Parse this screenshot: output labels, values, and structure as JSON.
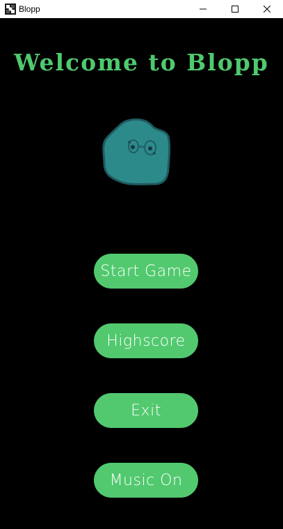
{
  "window": {
    "title": "Blopp",
    "icon": "blopp-app-icon",
    "controls": {
      "minimize": "—",
      "maximize": "☐",
      "close": "✕"
    }
  },
  "welcome_text": "Welcome to Blopp",
  "mascot": {
    "icon": "blob-mascot",
    "color": "#2f8c8c"
  },
  "menu": {
    "start_game": "Start Game",
    "highscore": "Highscore",
    "exit": "Exit",
    "music": "Music On"
  },
  "colors": {
    "accent": "#52c96f",
    "background": "#000000",
    "button_text": "#ffffff"
  }
}
